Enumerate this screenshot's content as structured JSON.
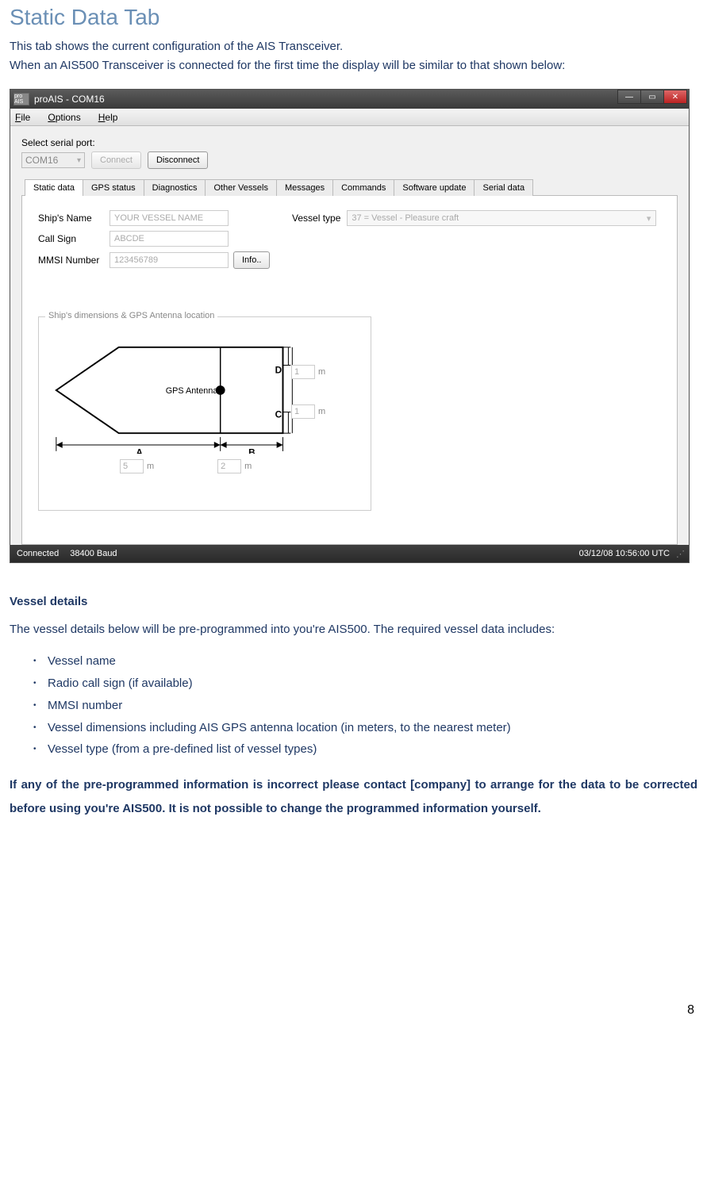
{
  "doc": {
    "heading": "Static Data Tab",
    "intro1": "This tab shows the current configuration of the AIS Transceiver.",
    "intro2": "When an AIS500 Transceiver is connected for the first time the display will be similar to that shown below:",
    "subheading": "Vessel details",
    "body1": "The vessel details below will be pre-programmed into you're AIS500. The required vessel data includes:",
    "bullets": [
      "Vessel name",
      "Radio call sign (if available)",
      "MMSI number",
      "Vessel dimensions including AIS GPS antenna location (in meters, to the nearest meter)",
      "Vessel type (from a pre-defined list of vessel types)"
    ],
    "bold": "If any of the pre-programmed information is incorrect please contact [company] to arrange for the data to be corrected before using you're AIS500. It is not possible to change the programmed information yourself.",
    "page": "8"
  },
  "app": {
    "icon_label": "pro AIS",
    "title": "proAIS - COM16",
    "menu": {
      "file": "File",
      "options": "Options",
      "help": "Help"
    },
    "port_label": "Select serial port:",
    "port_value": "COM16",
    "connect": "Connect",
    "disconnect": "Disconnect",
    "tabs": [
      "Static data",
      "GPS status",
      "Diagnostics",
      "Other Vessels",
      "Messages",
      "Commands",
      "Software update",
      "Serial data"
    ],
    "fields": {
      "ship_name_label": "Ship's Name",
      "ship_name_value": "YOUR VESSEL NAME",
      "call_sign_label": "Call Sign",
      "call_sign_value": "ABCDE",
      "mmsi_label": "MMSI Number",
      "mmsi_value": "123456789",
      "info_btn": "Info..",
      "vessel_type_label": "Vessel type",
      "vessel_type_value": "37 =  Vessel - Pleasure craft"
    },
    "groupbox_legend": "Ship's dimensions & GPS Antenna location",
    "gps_label": "GPS Antenna",
    "dims": {
      "A_label": "A",
      "A_value": "5",
      "B_label": "B",
      "B_value": "2",
      "C_label": "C",
      "C_value": "1",
      "D_label": "D",
      "D_value": "1",
      "unit": "m"
    },
    "status": {
      "connected": "Connected",
      "baud": "38400 Baud",
      "datetime": "03/12/08  10:56:00 UTC"
    }
  }
}
